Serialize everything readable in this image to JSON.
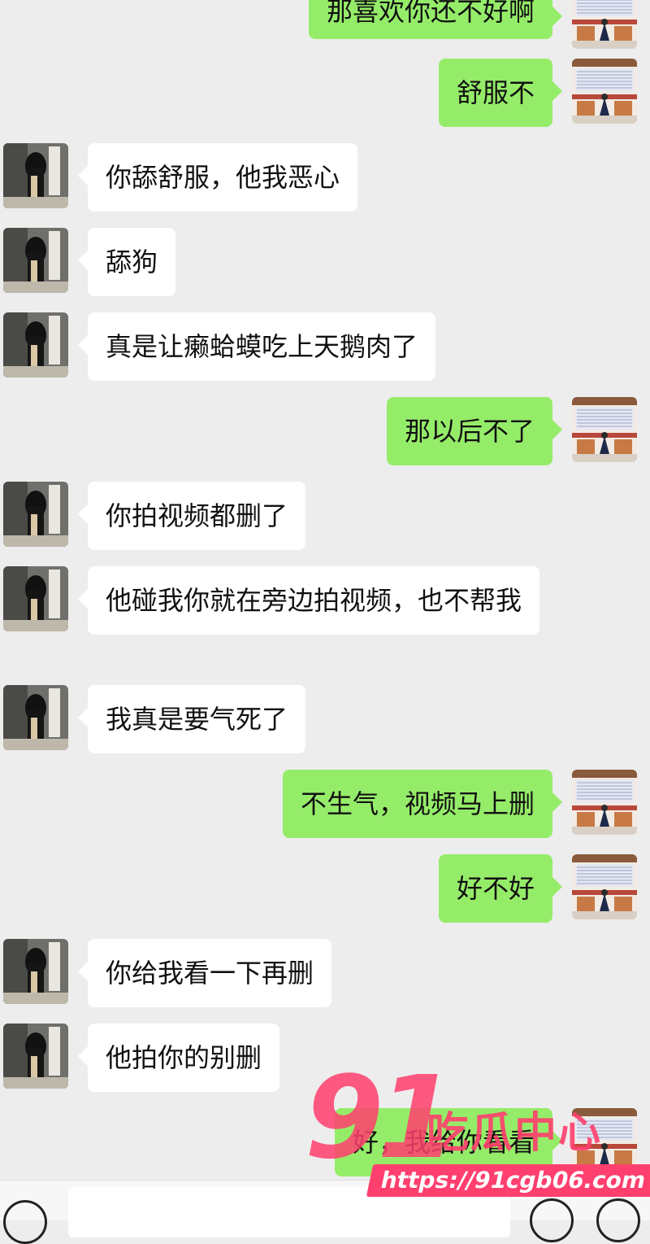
{
  "conversation": {
    "messages": [
      {
        "from": "me",
        "text": "那喜欢你还不好啊"
      },
      {
        "from": "me",
        "text": "舒服不"
      },
      {
        "from": "other",
        "text": "你舔舒服，他我恶心"
      },
      {
        "from": "other",
        "text": "舔狗"
      },
      {
        "from": "other",
        "text": "真是让癞蛤蟆吃上天鹅肉了"
      },
      {
        "from": "me",
        "text": "那以后不了"
      },
      {
        "from": "other",
        "text": "你拍视频都删了"
      },
      {
        "from": "other",
        "text": "他碰我你就在旁边拍视频，也不帮我"
      },
      {
        "from": "other",
        "text": "我真是要气死了"
      },
      {
        "from": "me",
        "text": "不生气，视频马上删"
      },
      {
        "from": "me",
        "text": "好不好"
      },
      {
        "from": "other",
        "text": "你给我看一下再删"
      },
      {
        "from": "other",
        "text": "他拍你的别删"
      },
      {
        "from": "me",
        "text": "好，我给你看看"
      }
    ]
  },
  "input_bar": {
    "voice_icon": "voice-icon",
    "emoji_icon": "emoji-icon",
    "plus_icon": "plus-icon"
  },
  "watermark": {
    "logo_number": "91",
    "logo_text": "吃瓜中心",
    "url": "https://91cgb06.com"
  },
  "colors": {
    "background": "#ededed",
    "outgoing_bubble": "#95ec69",
    "incoming_bubble": "#ffffff",
    "watermark": "#ff3f6e"
  }
}
